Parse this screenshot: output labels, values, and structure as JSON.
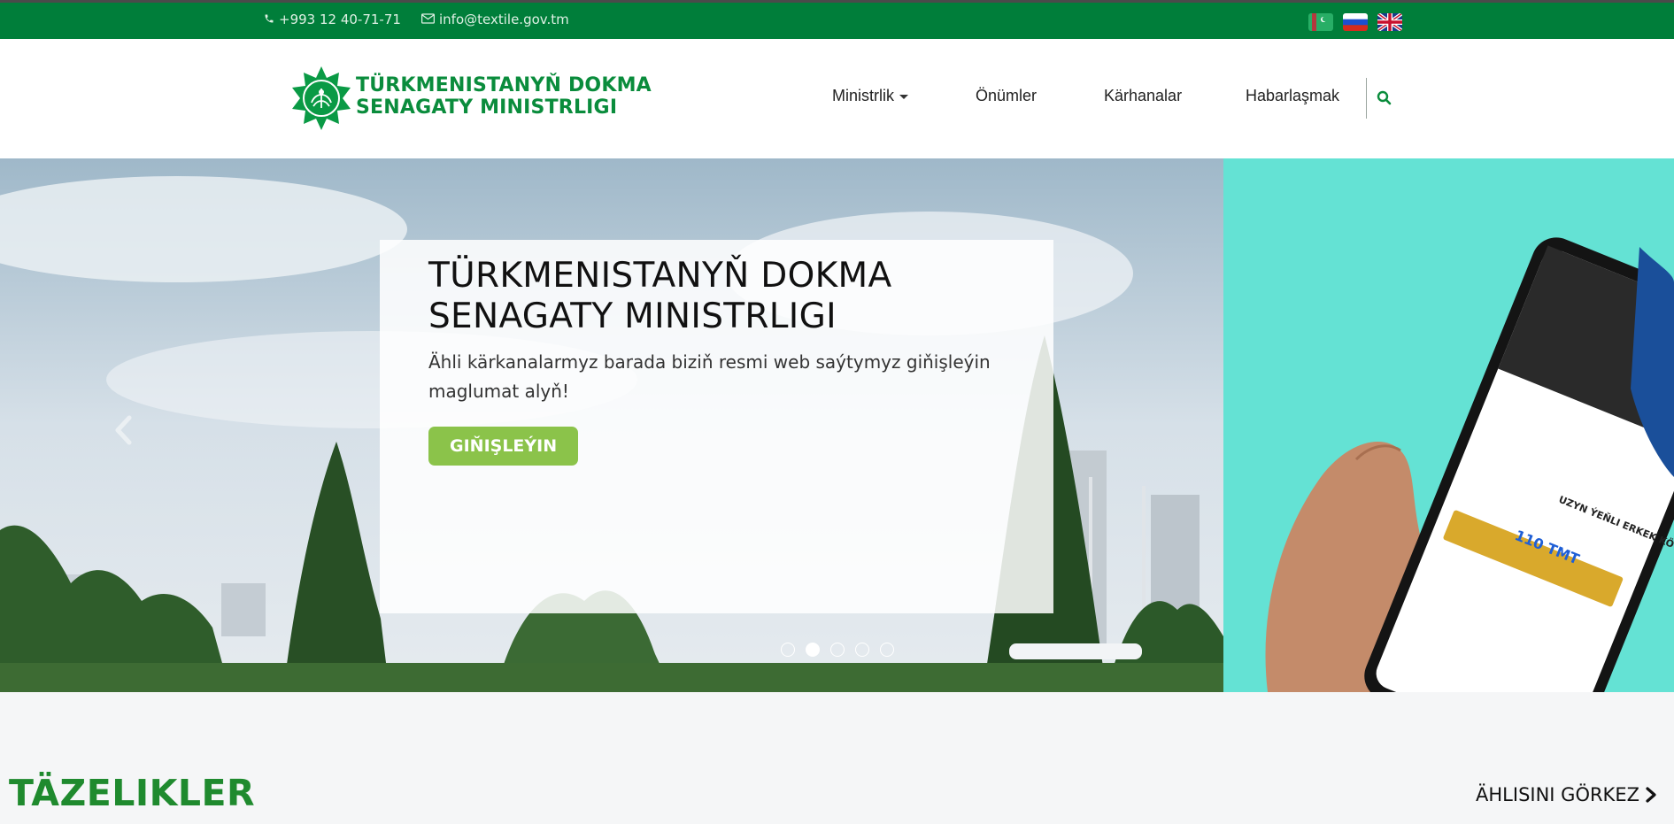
{
  "topbar": {
    "phone": "+993 12 40-71-71",
    "email": "info@textile.gov.tm",
    "phone_icon": "phone-icon",
    "email_icon": "envelope-icon",
    "languages": [
      {
        "name": "turkmen-flag-icon",
        "code": "tk"
      },
      {
        "name": "russian-flag-icon",
        "code": "ru"
      },
      {
        "name": "british-flag-icon",
        "code": "en"
      }
    ]
  },
  "header": {
    "logo_line1": "TÜRKMENISTANYŇ DOKMA",
    "logo_line2": "SENAGATY MINISTRLIGI",
    "nav": {
      "ministry": "Ministrlik",
      "products": "Önümler",
      "factories": "Kärhanalar",
      "contact": "Habarlaşmak"
    },
    "search_icon": "search-icon"
  },
  "hero": {
    "title_line1": "TÜRKMENISTANYŇ DOKMA",
    "title_line2": "SENAGATY MINISTRLIGI",
    "subtitle": "Ähli kärkanalarmyz barada biziň resmi web saýtymyz giňişleýin maglumat alyň!",
    "button_label": "GIŇIŞLEÝIN",
    "slides_count": 5,
    "active_slide": 2,
    "promo": {
      "product_title": "UZYN ÝEŇLI ERKEK KÖÝNEG",
      "price": "110 TMT"
    }
  },
  "news": {
    "title": "TÄZELIKLER",
    "see_all": "ÄHLISINI GÖRKEZ"
  },
  "colors": {
    "brand_green": "#007e3a",
    "logo_green": "#0a8c3c",
    "button_green": "#8bc34a",
    "news_title_green": "#1f8a2e",
    "promo_teal": "#64e2d4"
  }
}
